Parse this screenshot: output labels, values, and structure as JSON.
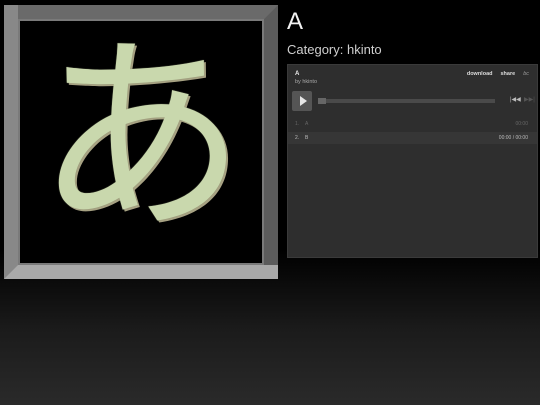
{
  "artwork": {
    "glyph": "あ",
    "glyph_color": "#c9d8ad"
  },
  "page": {
    "title": "A",
    "category": "Category: hkinto"
  },
  "player": {
    "track_title": "A",
    "artist": "by hkinto",
    "download_label": "download",
    "share_label": "share",
    "brand_mark": "bc",
    "tracks": [
      {
        "num": "1.",
        "name": "A",
        "time": "00:00",
        "active": false
      },
      {
        "num": "2.",
        "name": "B",
        "time": "00:00 / 00:00",
        "active": true
      }
    ]
  },
  "colors": {
    "background": "#000000",
    "player_bg": "#2e2e2e",
    "frame": "#7a7a7a"
  }
}
